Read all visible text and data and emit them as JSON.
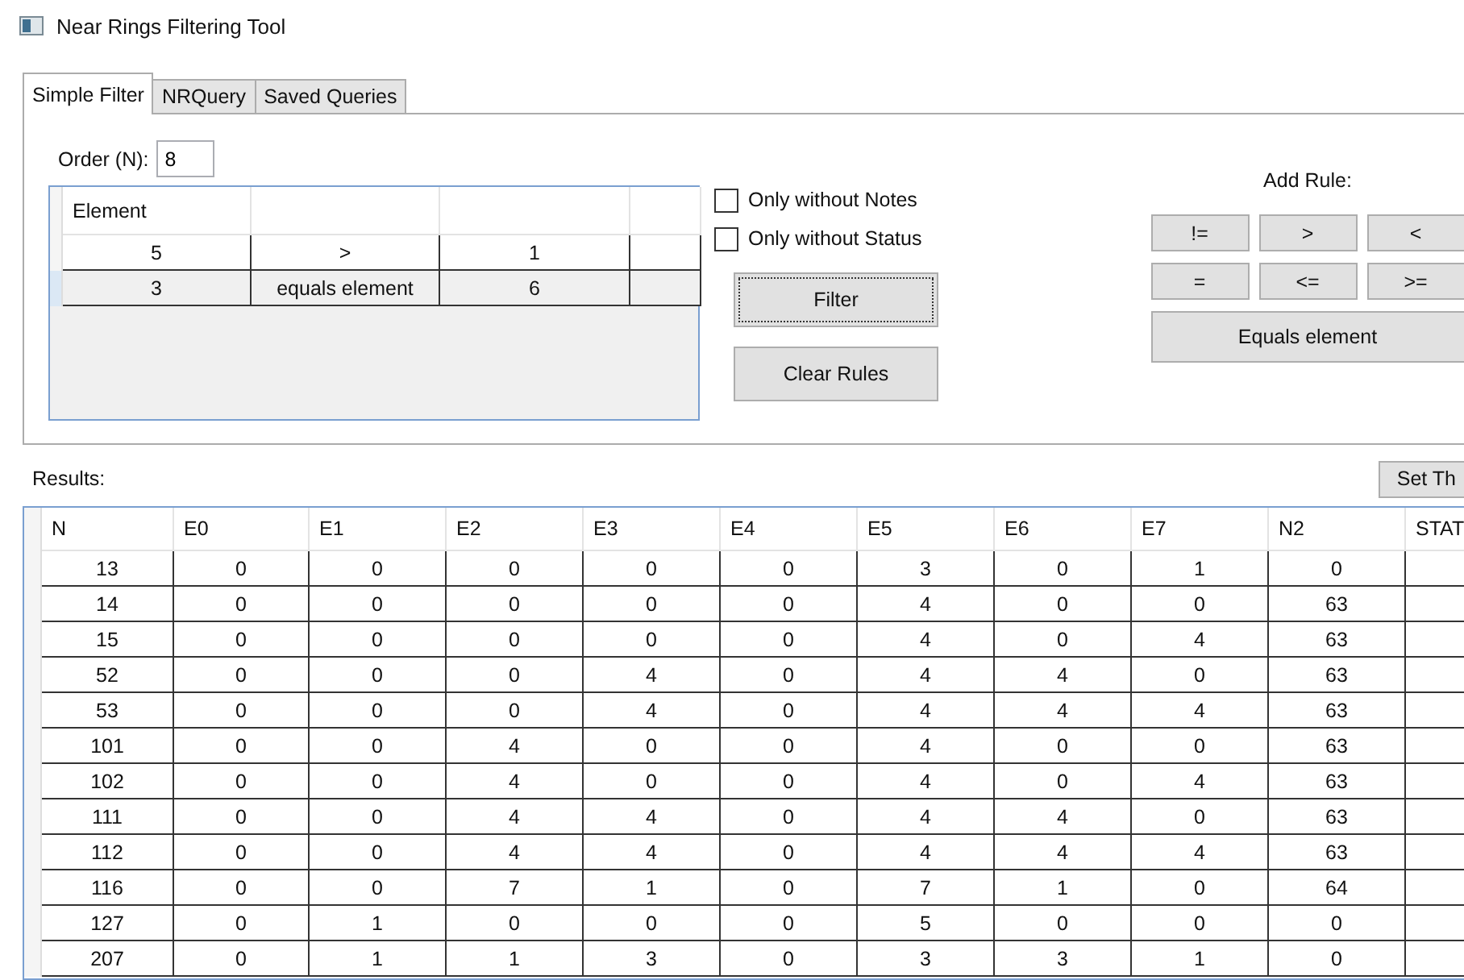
{
  "window": {
    "title": "Near Rings Filtering Tool"
  },
  "tabs": [
    {
      "label": "Simple Filter",
      "selected": true
    },
    {
      "label": "NRQuery",
      "selected": false
    },
    {
      "label": "Saved Queries",
      "selected": false
    }
  ],
  "order": {
    "label": "Order (N):",
    "value": "8"
  },
  "rules": {
    "columns": [
      "Element",
      "",
      "",
      ""
    ],
    "rows": [
      {
        "cells": [
          "5",
          ">",
          "1",
          ""
        ],
        "selected": false
      },
      {
        "cells": [
          "3",
          "equals element",
          "6",
          ""
        ],
        "selected": true
      }
    ]
  },
  "options": [
    {
      "label": "Only without Notes",
      "checked": false
    },
    {
      "label": "Only without Status",
      "checked": false
    }
  ],
  "actions": [
    {
      "label": "Filter",
      "focused": true
    },
    {
      "label": "Clear Rules",
      "focused": false
    }
  ],
  "add_rule": {
    "label": "Add Rule:",
    "operators": [
      "!=",
      ">",
      "<",
      "=",
      "<=",
      ">="
    ],
    "wide": "Equals element"
  },
  "results": {
    "label": "Results:",
    "button": "Set Th",
    "columns": [
      "N",
      "E0",
      "E1",
      "E2",
      "E3",
      "E4",
      "E5",
      "E6",
      "E7",
      "N2",
      "STAT"
    ],
    "rows": [
      [
        "13",
        "0",
        "0",
        "0",
        "0",
        "0",
        "3",
        "0",
        "1",
        "0",
        ""
      ],
      [
        "14",
        "0",
        "0",
        "0",
        "0",
        "0",
        "4",
        "0",
        "0",
        "63",
        ""
      ],
      [
        "15",
        "0",
        "0",
        "0",
        "0",
        "0",
        "4",
        "0",
        "4",
        "63",
        ""
      ],
      [
        "52",
        "0",
        "0",
        "0",
        "4",
        "0",
        "4",
        "4",
        "0",
        "63",
        ""
      ],
      [
        "53",
        "0",
        "0",
        "0",
        "4",
        "0",
        "4",
        "4",
        "4",
        "63",
        ""
      ],
      [
        "101",
        "0",
        "0",
        "4",
        "0",
        "0",
        "4",
        "0",
        "0",
        "63",
        ""
      ],
      [
        "102",
        "0",
        "0",
        "4",
        "0",
        "0",
        "4",
        "0",
        "4",
        "63",
        ""
      ],
      [
        "111",
        "0",
        "0",
        "4",
        "4",
        "0",
        "4",
        "4",
        "0",
        "63",
        ""
      ],
      [
        "112",
        "0",
        "0",
        "4",
        "4",
        "0",
        "4",
        "4",
        "4",
        "63",
        ""
      ],
      [
        "116",
        "0",
        "0",
        "7",
        "1",
        "0",
        "7",
        "1",
        "0",
        "64",
        ""
      ],
      [
        "127",
        "0",
        "1",
        "0",
        "0",
        "0",
        "5",
        "0",
        "0",
        "0",
        ""
      ],
      [
        "207",
        "0",
        "1",
        "1",
        "3",
        "0",
        "3",
        "3",
        "1",
        "0",
        ""
      ]
    ]
  }
}
